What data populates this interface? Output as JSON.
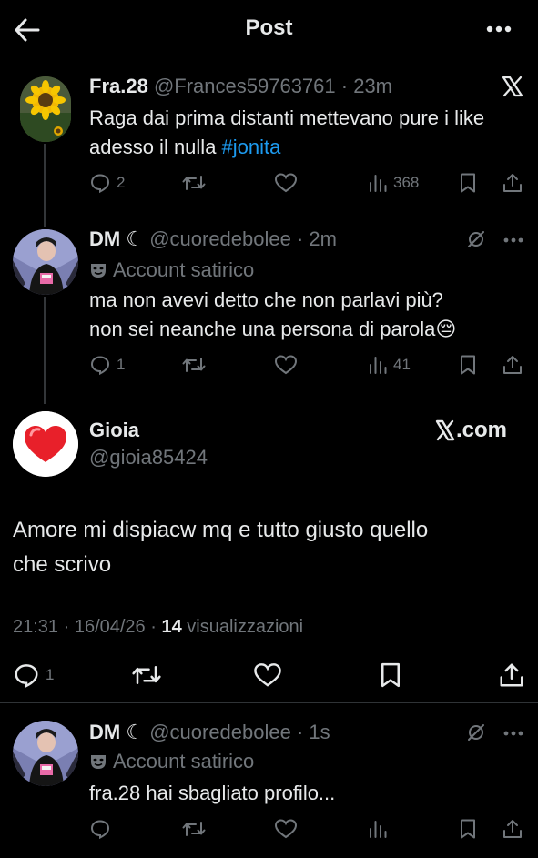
{
  "header": {
    "title": "Post"
  },
  "thread_top": {
    "name": "Fra.28",
    "handle": "@Frances59763761",
    "time": "· 23m",
    "text_line1": "Raga dai prima distanti mettevano pure i like",
    "text_line2_prefix": "adesso il nulla ",
    "hashtag": "#jonita",
    "replies": "2",
    "views": "368"
  },
  "thread_reply": {
    "name": "DM ☾",
    "handle": "@cuoredebolee",
    "time": "· 2m",
    "label": "Account satirico",
    "text_line1": "ma non avevi detto che non parlavi più?",
    "text_line2": "non sei neanche una persona di parola😔",
    "replies": "1",
    "views": "41"
  },
  "main_post": {
    "name": "Gioia",
    "handle": "@gioia85424",
    "watermark": "X.com",
    "text_line1": "Amore mi dispiacw mq e tutto giusto quello",
    "text_line2": "che scrivo",
    "meta_time": "21:31 · 16/04/26 · ",
    "meta_views": "14",
    "meta_views_label": " visualizzazioni",
    "replies": "1"
  },
  "bottom_reply": {
    "name": "DM ☾",
    "handle": "@cuoredebolee",
    "time": "· 1s",
    "label": "Account satirico",
    "text": "fra.28 hai sbagliato profilo..."
  },
  "icons": [
    "back-arrow-icon",
    "more-icon",
    "x-logo-icon",
    "reply-icon",
    "repost-icon",
    "like-icon",
    "views-icon",
    "bookmark-icon",
    "share-icon",
    "grok-icon",
    "mask-icon",
    "heart-emoji"
  ],
  "colors": {
    "background": "#000000",
    "text": "#e7e9ea",
    "muted": "#71767b",
    "link": "#1d9bf0",
    "divider": "#2f3336"
  }
}
